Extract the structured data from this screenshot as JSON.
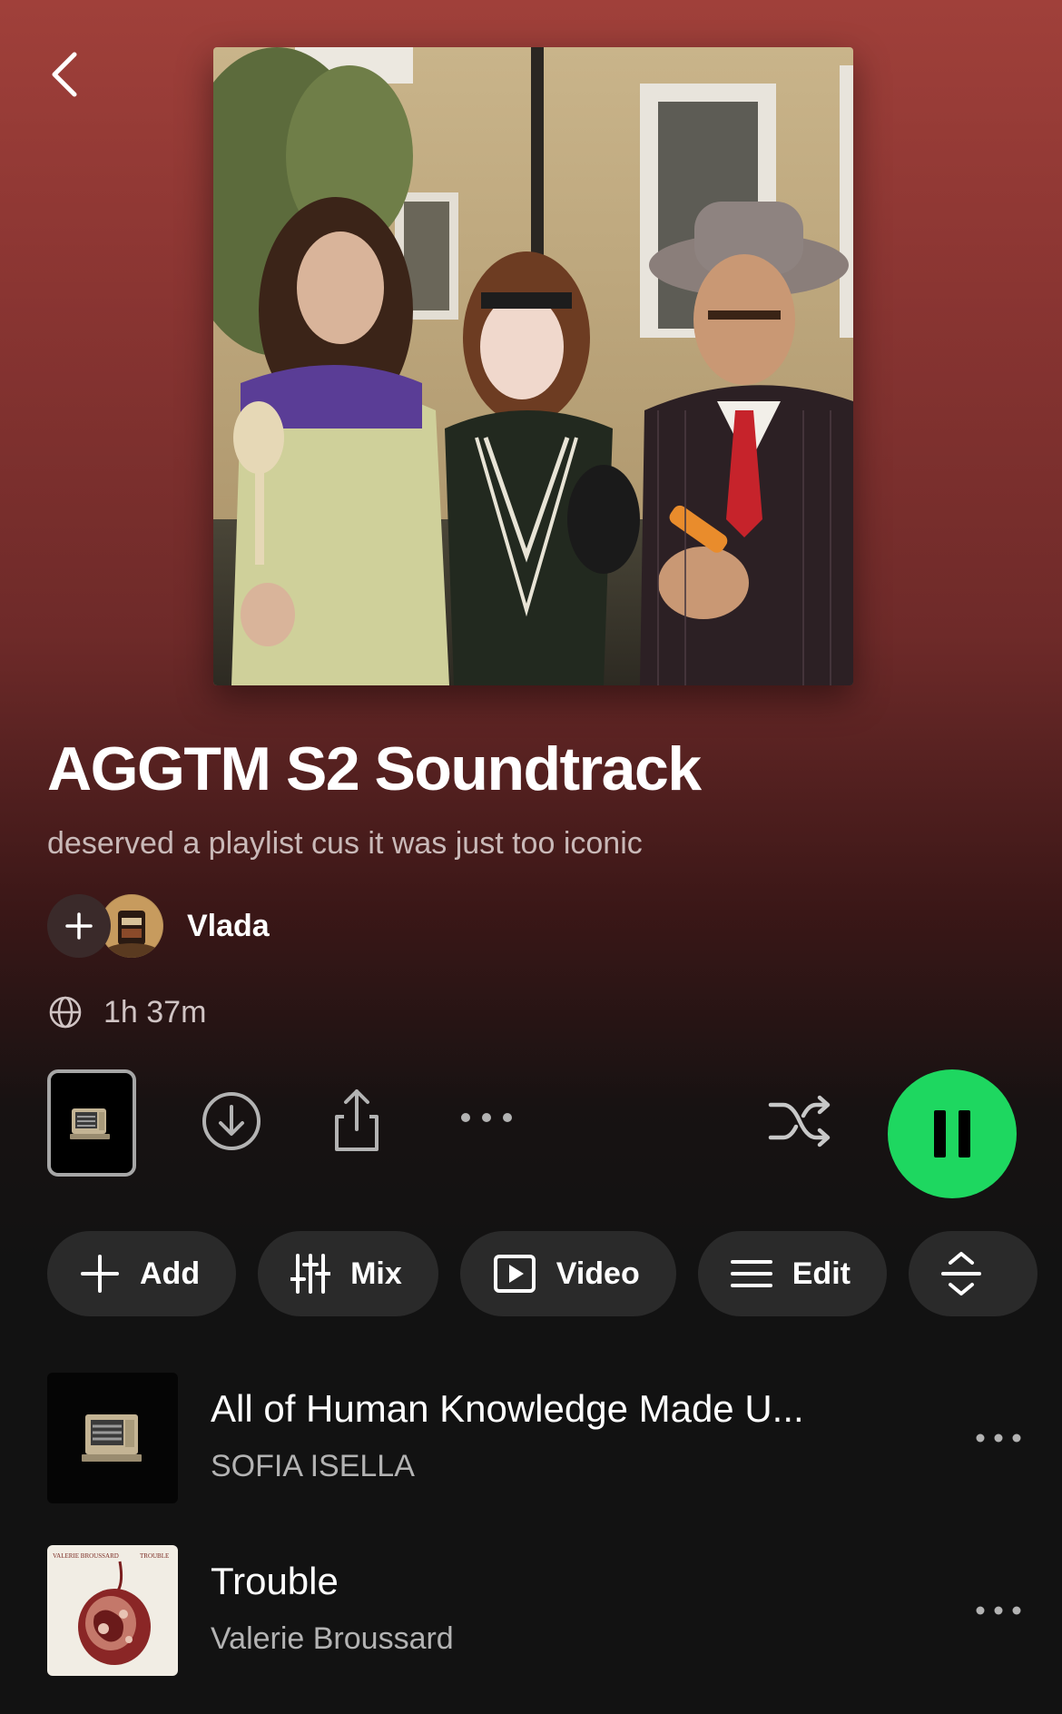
{
  "playlist": {
    "title": "AGGTM S2 Soundtrack",
    "description": "deserved a playlist cus it was just too iconic",
    "owner": "Vlada",
    "duration": "1h 37m",
    "visibility_icon": "globe-icon"
  },
  "controls": {
    "download_icon": "download-icon",
    "share_icon": "share-icon",
    "more_icon": "more-icon",
    "shuffle_icon": "shuffle-icon",
    "play_state": "playing",
    "accent_color": "#1ed760"
  },
  "chips": [
    {
      "label": "Add",
      "icon": "plus-icon"
    },
    {
      "label": "Mix",
      "icon": "sliders-icon"
    },
    {
      "label": "Video",
      "icon": "video-icon"
    },
    {
      "label": "Edit",
      "icon": "list-icon"
    }
  ],
  "tracks": [
    {
      "title": "All of Human Knowledge Made U...",
      "artist": "SOFIA ISELLA"
    },
    {
      "title": "Trouble",
      "artist": "Valerie Broussard"
    }
  ],
  "album_art_text": {
    "left": "VALERIE BROUSSARD",
    "right": "TROUBLE"
  }
}
